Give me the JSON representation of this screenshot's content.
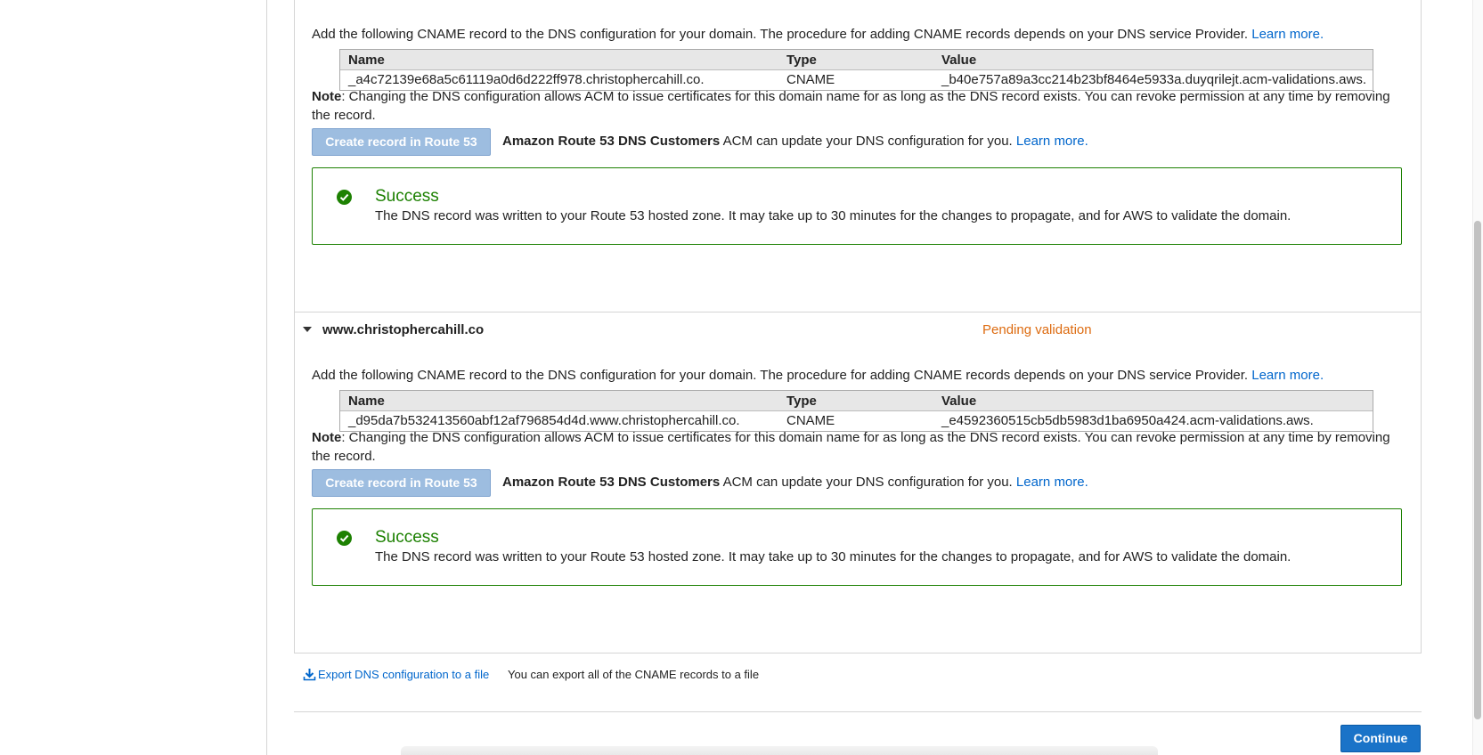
{
  "validation": {
    "instruction": "Add the following CNAME record to the DNS configuration for your domain. The procedure for adding CNAME records depends on your DNS service Provider.",
    "learn_more": "Learn more.",
    "table_headers": {
      "name": "Name",
      "type": "Type",
      "value": "Value"
    },
    "note_label": "Note",
    "note_text": ": Changing the DNS configuration allows ACM to issue certificates for this domain name for as long as the DNS record exists. You can revoke permission at any time by removing the record.",
    "create_record_button": "Create record in Route 53",
    "route53_customers": "Amazon Route 53 DNS Customers",
    "route53_text": "ACM can update your DNS configuration for you.",
    "success_title": "Success",
    "success_message": "The DNS record was written to your Route 53 hosted zone. It may take up to 30 minutes for the changes to propagate, and for AWS to validate the domain."
  },
  "domains": [
    {
      "record": {
        "name": "_a4c72139e68a5c61119a0d6d222ff978.christophercahill.co.",
        "type": "CNAME",
        "value": "_b40e757a89a3cc214b23bf8464e5933a.duyqrilejt.acm-validations.aws."
      }
    },
    {
      "domain_name": "www.christophercahill.co",
      "status": "Pending validation",
      "record": {
        "name": "_d95da7b532413560abf12af796854d4d.www.christophercahill.co.",
        "type": "CNAME",
        "value": "_e4592360515cb5db5983d1ba6950a424.acm-validations.aws."
      }
    }
  ],
  "export": {
    "link_label": "Export DNS configuration to a file",
    "hint": "You can export all of the CNAME records to a file"
  },
  "footer": {
    "continue_label": "Continue"
  },
  "colors": {
    "link": "#0066cc",
    "success": "#1d8102",
    "pending": "#dd6b10",
    "primary_button": "#1a73c8",
    "disabled_button": "#9dbde0"
  }
}
